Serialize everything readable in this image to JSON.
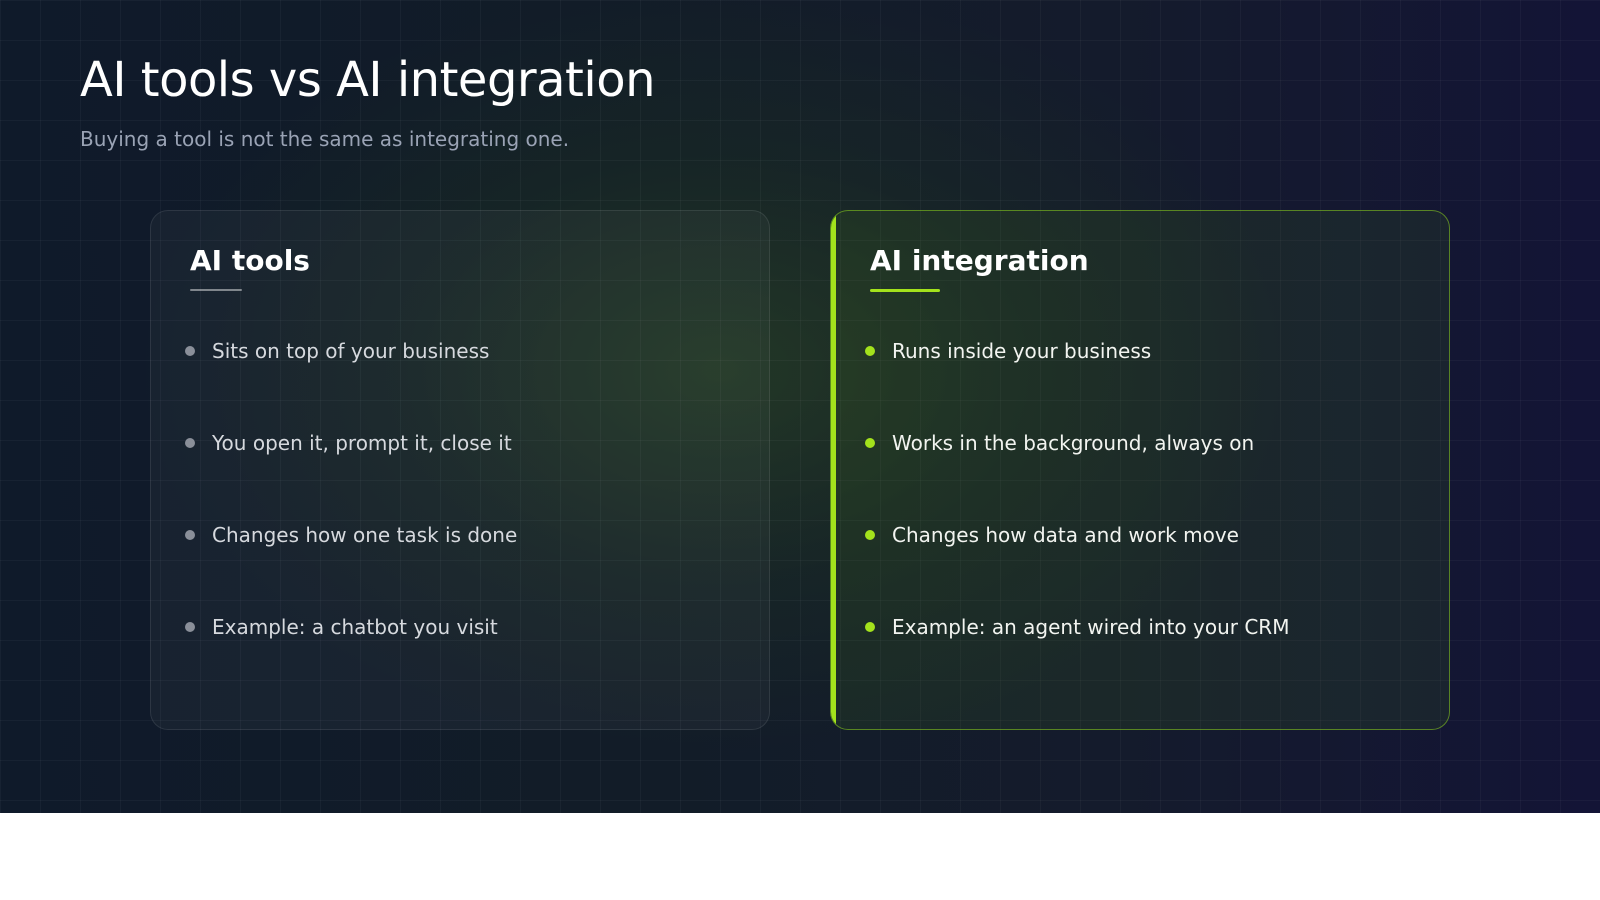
{
  "slide": {
    "title": "AI tools vs AI integration",
    "subtitle": "Buying a tool is not the same as integrating one."
  },
  "cards": {
    "tools": {
      "title": "AI tools",
      "items": [
        "Sits on top of your business",
        "You open it, prompt it, close it",
        "Changes how one task is done",
        "Example: a chatbot you visit"
      ]
    },
    "integration": {
      "title": "AI integration",
      "items": [
        "Runs inside your business",
        "Works in the background, always on",
        "Changes how data and work move",
        "Example: an agent wired into your CRM"
      ]
    }
  },
  "colors": {
    "accent": "#a3e21c",
    "background": "#121c28",
    "muted_dot": "#8a8f99"
  }
}
